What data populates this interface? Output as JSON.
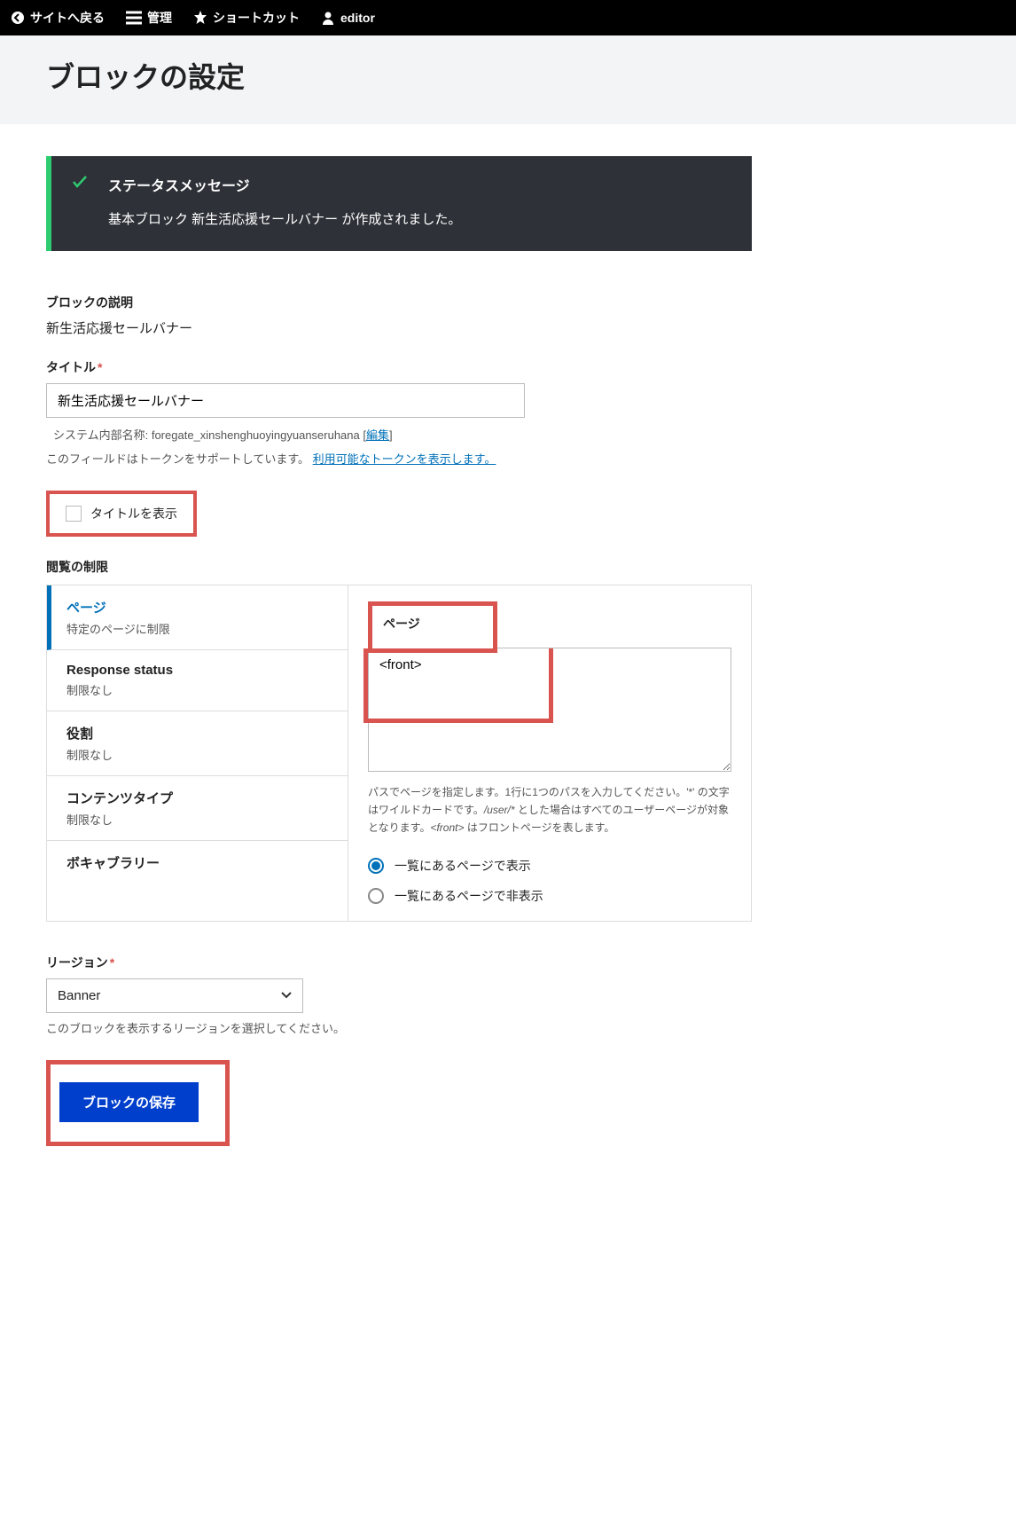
{
  "toolbar": {
    "back": "サイトへ戻る",
    "manage": "管理",
    "shortcuts": "ショートカット",
    "user": "editor"
  },
  "page": {
    "title": "ブロックの設定"
  },
  "message": {
    "title": "ステータスメッセージ",
    "body": "基本ブロック 新生活応援セールバナー が作成されました。"
  },
  "block_description": {
    "label": "ブロックの説明",
    "value": "新生活応援セールバナー"
  },
  "title_field": {
    "label": "タイトル",
    "value": "新生活応援セールバナー",
    "machine_prefix": "システム内部名称: ",
    "machine_name": "foregate_xinshenghuoyingyuanseruhana",
    "edit_link": "編集",
    "token_help_prefix": "このフィールドはトークンをサポートしています。 ",
    "token_link": "利用可能なトークンを表示します。"
  },
  "display_title": {
    "label": "タイトルを表示"
  },
  "visibility": {
    "label": "閲覧の制限",
    "tabs": [
      {
        "title": "ページ",
        "sub": "特定のページに制限"
      },
      {
        "title": "Response status",
        "sub": "制限なし"
      },
      {
        "title": "役割",
        "sub": "制限なし"
      },
      {
        "title": "コンテンツタイプ",
        "sub": "制限なし"
      },
      {
        "title": "ボキャブラリー",
        "sub": ""
      }
    ],
    "panel": {
      "label": "ページ",
      "value": "<front>",
      "description_0": "パスでページを指定します。1行に1つのパスを入力してください。'*' の文字はワイルドカードです。",
      "description_1": "/user/*",
      "description_2": " とした場合はすべてのユーザーページが対象となります。",
      "description_3": "<front>",
      "description_4": " はフロントページを表します。",
      "radio_show": "一覧にあるページで表示",
      "radio_hide": "一覧にあるページで非表示"
    }
  },
  "region": {
    "label": "リージョン",
    "value": "Banner",
    "help": "このブロックを表示するリージョンを選択してください。"
  },
  "save": {
    "label": "ブロックの保存"
  }
}
